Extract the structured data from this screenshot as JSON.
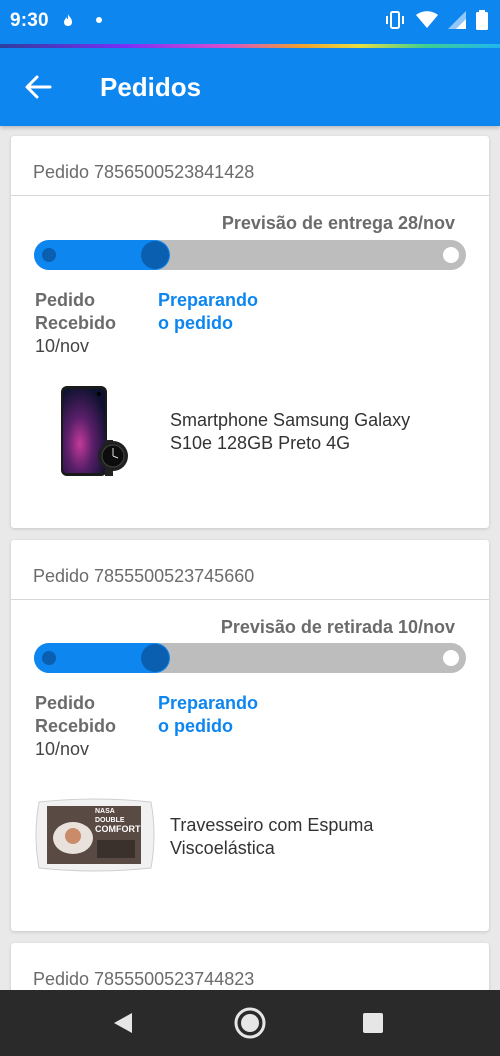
{
  "status_bar": {
    "time": "9:30",
    "icons": [
      "fire-icon",
      "dot-icon",
      "vibrate-icon",
      "wifi-icon",
      "signal-icon",
      "battery-icon"
    ]
  },
  "app_bar": {
    "title": "Pedidos",
    "back_icon": "arrow-left-icon"
  },
  "orders": [
    {
      "header": "Pedido 7856500523841428",
      "forecast": "Previsão de entrega 28/nov",
      "progress": 0.28,
      "step1_line1": "Pedido",
      "step1_line2": "Recebido",
      "step1_date": "10/nov",
      "step2_line1": "Preparando",
      "step2_line2": "o pedido",
      "product_line1": "Smartphone Samsung Galaxy",
      "product_line2": "S10e 128GB Preto 4G"
    },
    {
      "header": "Pedido 7855500523745660",
      "forecast": "Previsão de retirada 10/nov",
      "progress": 0.28,
      "step1_line1": "Pedido",
      "step1_line2": "Recebido",
      "step1_date": "10/nov",
      "step2_line1": "Preparando",
      "step2_line2": "o pedido",
      "product_line1": "Travesseiro com Espuma",
      "product_line2": "Viscoelástica",
      "product_image_text_1": "NASA DOUBLE",
      "product_image_text_2": "COMFORT"
    },
    {
      "header": "Pedido 7855500523744823"
    }
  ],
  "colors": {
    "primary": "#0e86f0",
    "primary_dark": "#0a5fb0",
    "track": "#bdbdbd"
  },
  "nav": {
    "back": "triangle-back-icon",
    "home": "circle-home-icon",
    "recents": "square-recents-icon"
  }
}
